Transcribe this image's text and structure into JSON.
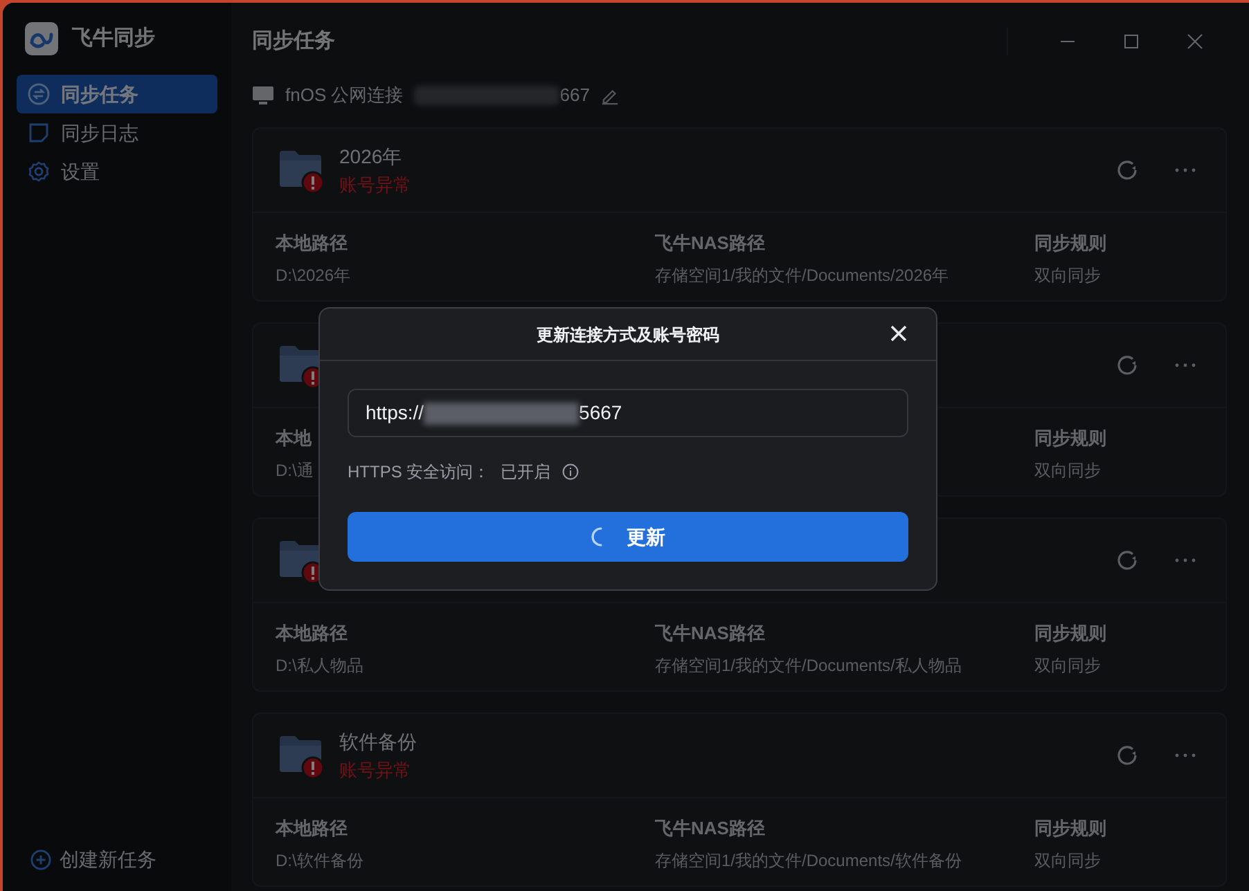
{
  "app": {
    "name": "飞牛同步"
  },
  "sidebar": {
    "items": [
      {
        "label": "同步任务",
        "selected": true
      },
      {
        "label": "同步日志",
        "selected": false
      },
      {
        "label": "设置",
        "selected": false
      }
    ],
    "create_button": "创建新任务"
  },
  "header": {
    "title": "同步任务"
  },
  "connection": {
    "label": "fnOS 公网连接",
    "address_tail": "667"
  },
  "tasks": [
    {
      "name": "2026年",
      "status": "账号异常",
      "local": {
        "label": "本地路径",
        "value": "D:\\2026年"
      },
      "nas": {
        "label": "飞牛NAS路径",
        "value": "存储空间1/我的文件/Documents/2026年"
      },
      "rule": {
        "label": "同步规则",
        "value": "双向同步"
      }
    },
    {
      "local": {
        "label": "本地",
        "value": "D:\\通"
      },
      "rule": {
        "label": "同步规则",
        "value": "双向同步"
      }
    },
    {
      "local": {
        "label": "本地路径",
        "value": "D:\\私人物品"
      },
      "nas": {
        "label": "飞牛NAS路径",
        "value": "存储空间1/我的文件/Documents/私人物品"
      },
      "rule": {
        "label": "同步规则",
        "value": "双向同步"
      }
    },
    {
      "name": "软件备份",
      "status": "账号异常",
      "local": {
        "label": "本地路径",
        "value": "D:\\软件备份"
      },
      "nas": {
        "label": "飞牛NAS路径",
        "value": "存储空间1/我的文件/Documents/软件备份"
      },
      "rule": {
        "label": "同步规则",
        "value": "双向同步"
      }
    }
  ],
  "dialog": {
    "title": "更新连接方式及账号密码",
    "url_prefix": "https://",
    "url_tail": "5667",
    "https_label": "HTTPS 安全访问：",
    "https_value": "已开启",
    "button": "更新",
    "loading": true
  }
}
